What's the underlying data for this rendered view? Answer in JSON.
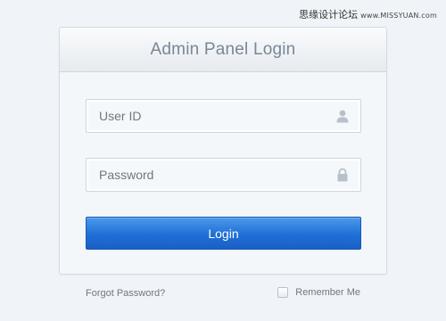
{
  "watermark": {
    "cn": "思缘设计论坛",
    "url": "www.MISSYUAN.com"
  },
  "panel": {
    "title": "Admin Panel Login"
  },
  "fields": {
    "user_id": {
      "placeholder": "User ID",
      "value": "",
      "icon": "user-icon"
    },
    "password": {
      "placeholder": "Password",
      "value": "",
      "icon": "lock-icon"
    }
  },
  "buttons": {
    "login_label": "Login"
  },
  "footer": {
    "forgot_label": "Forgot Password?",
    "remember_label": "Remember Me",
    "remember_checked": false
  },
  "colors": {
    "background": "#f0f4f8",
    "panel_title": "#7a8796",
    "button_primary": "#1f6fd6"
  }
}
